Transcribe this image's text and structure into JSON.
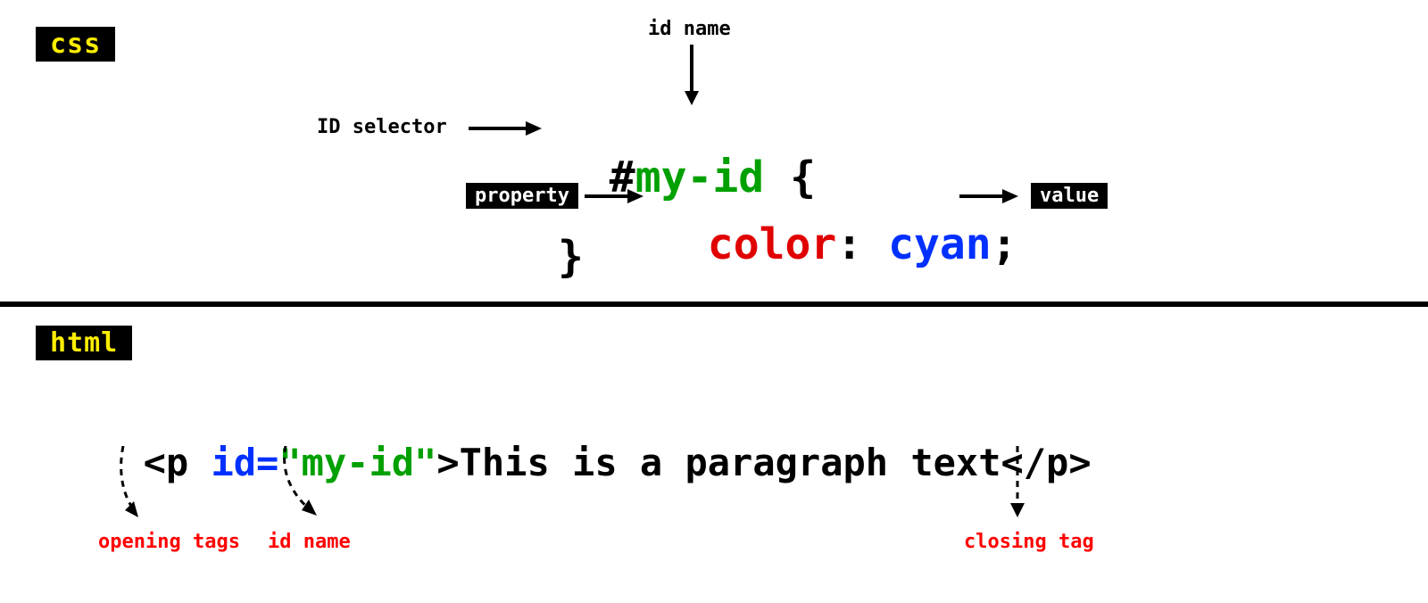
{
  "badges": {
    "css": "css",
    "html": "html"
  },
  "annotations": {
    "id_name": "id name",
    "id_selector": "ID selector",
    "property": "property",
    "value": "value",
    "opening_tags": "opening tags",
    "id_name_html": "id name",
    "closing_tag": "closing tag"
  },
  "css_code": {
    "hash": "#",
    "id": "my-id",
    "open_brace": " {",
    "property": "color",
    "colon": ": ",
    "value": "cyan",
    "semicolon": ";",
    "close_brace": "}"
  },
  "html_code": {
    "open_lt": "<p ",
    "attr_name": "id=",
    "attr_value": "\"my-id\"",
    "open_gt": ">",
    "text": "This is a paragraph text",
    "close_tag": "</p>"
  }
}
